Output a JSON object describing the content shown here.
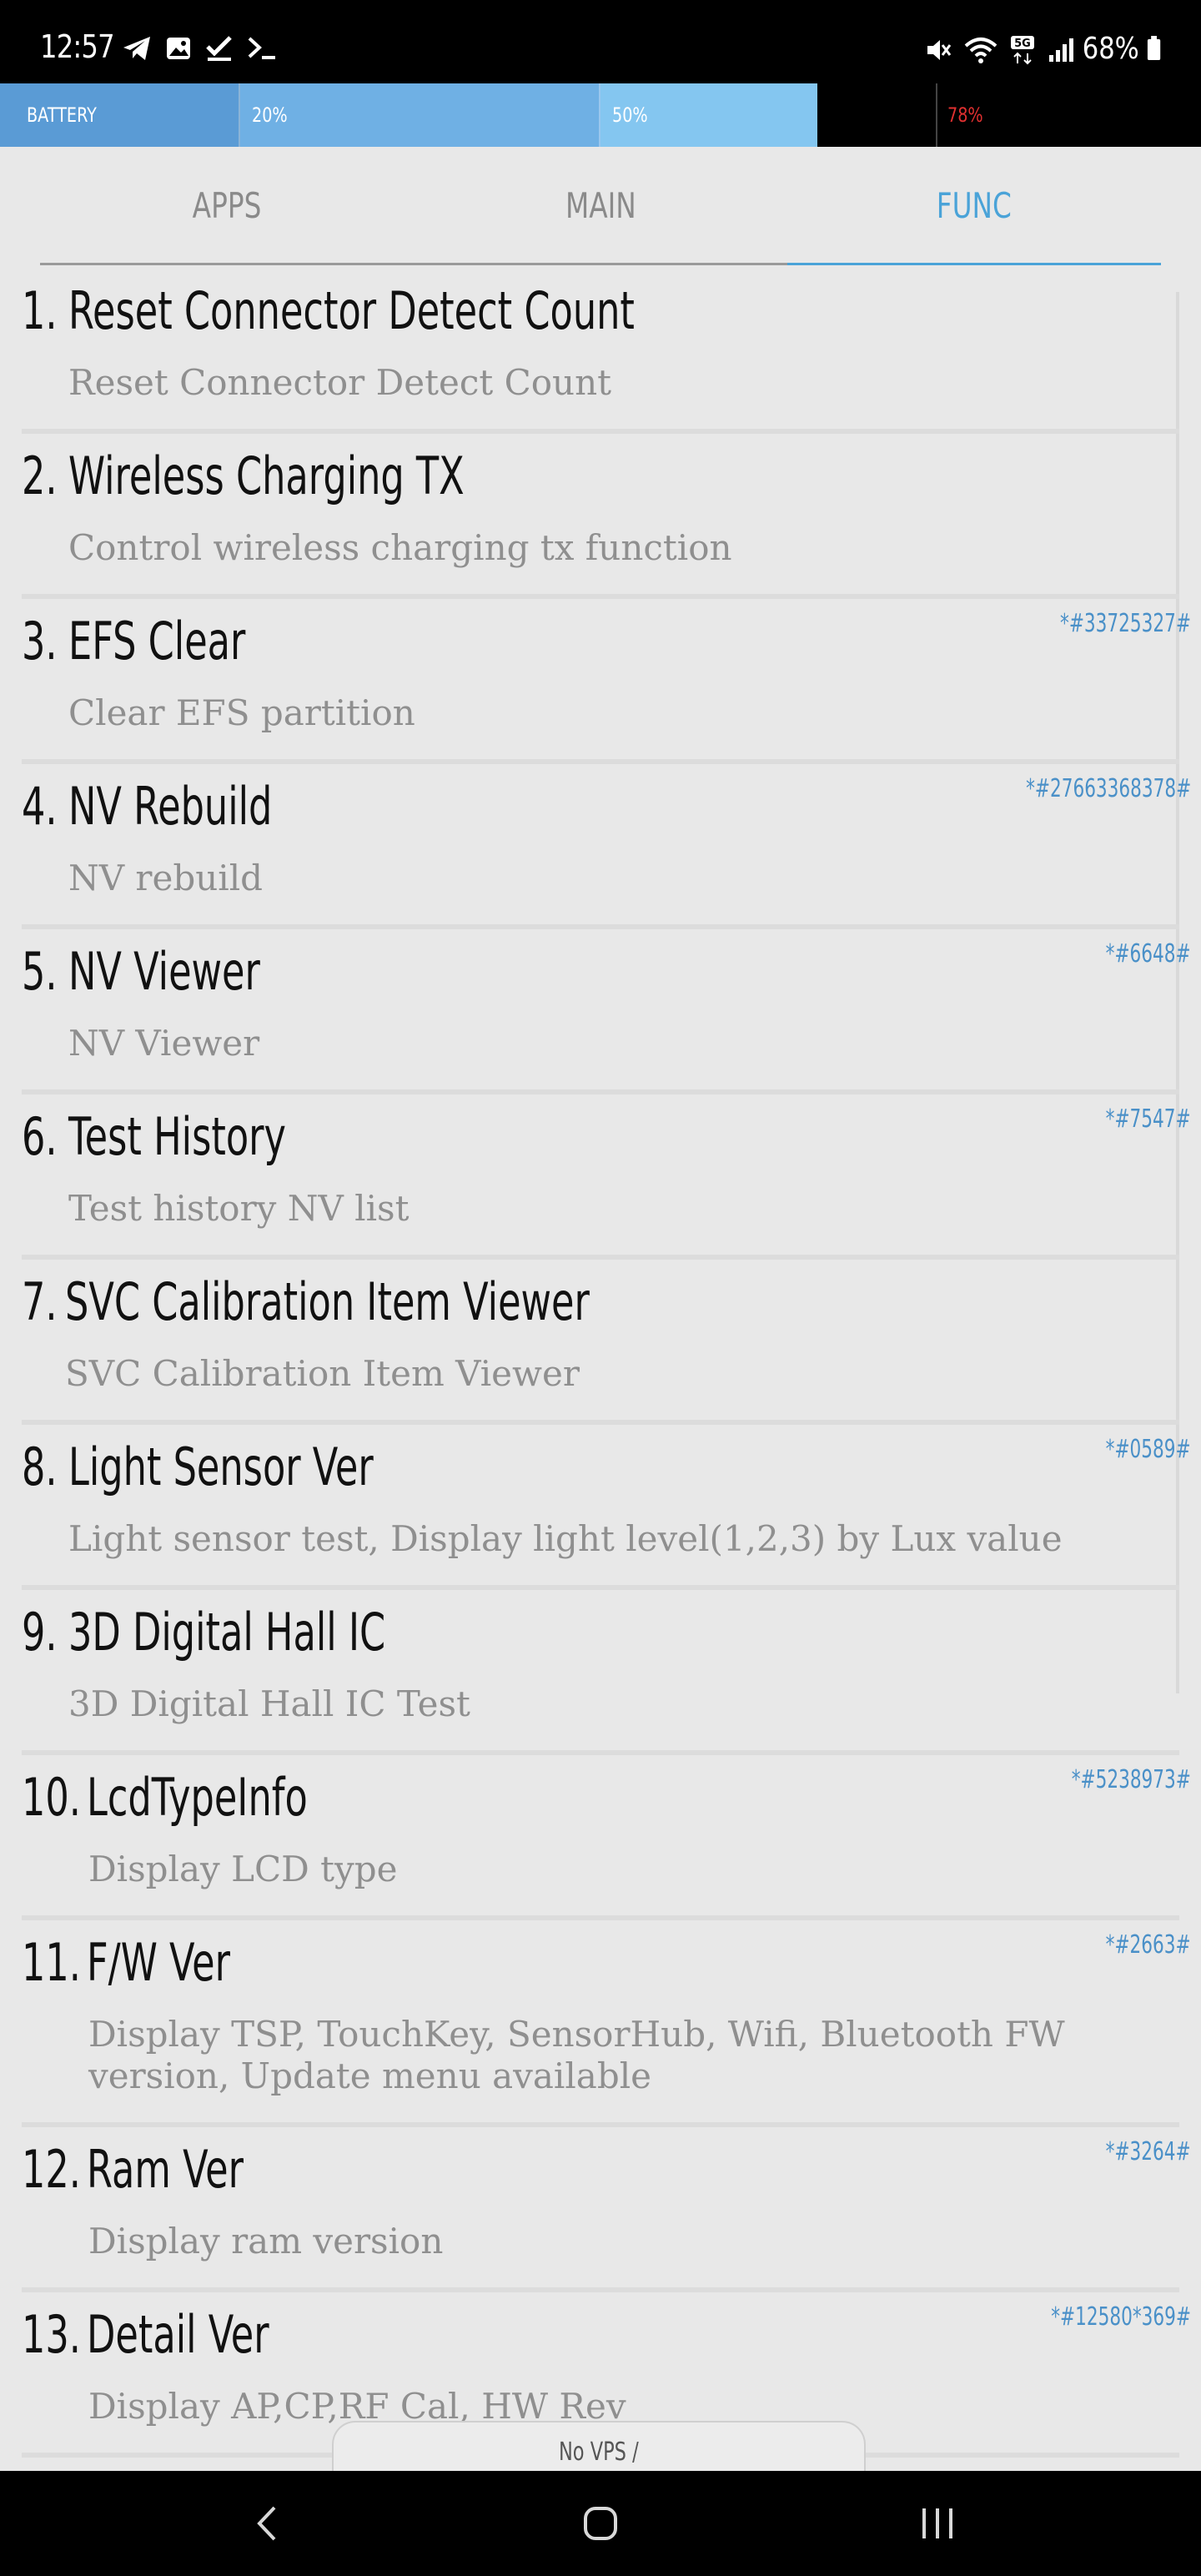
{
  "status_bar": {
    "time": "12:57",
    "battery_percent": "68%",
    "left_icons": [
      "telegram-icon",
      "gallery-icon",
      "checkmark-icon",
      "terminal-icon"
    ],
    "right_icons": [
      "mute-icon",
      "wifi-icon",
      "5g-icon",
      "signal-icon",
      "battery-icon"
    ]
  },
  "battery_bar": {
    "label": "BATTERY",
    "marker_20": "20%",
    "marker_50": "50%",
    "level": "78%",
    "level_color": "#e03030"
  },
  "tabs": [
    {
      "label": "APPS",
      "active": false
    },
    {
      "label": "MAIN",
      "active": false
    },
    {
      "label": "FUNC",
      "active": true
    }
  ],
  "accent_color": "#4aa3d8",
  "items": [
    {
      "num": "1.",
      "title": "Reset Connector Detect Count",
      "desc": "Reset Connector Detect Count",
      "code": ""
    },
    {
      "num": "2.",
      "title": "Wireless Charging TX",
      "desc": "Control wireless charging tx function",
      "code": ""
    },
    {
      "num": "3.",
      "title": "EFS Clear",
      "desc": "Clear EFS partition",
      "code": "*#33725327#"
    },
    {
      "num": "4.",
      "title": "NV Rebuild",
      "desc": "NV rebuild",
      "code": "*#27663368378#"
    },
    {
      "num": "5.",
      "title": "NV Viewer",
      "desc": "NV Viewer",
      "code": "*#6648#"
    },
    {
      "num": "6.",
      "title": "Test History",
      "desc": "Test history NV list",
      "code": "*#7547#"
    },
    {
      "num": "7.",
      "title": "SVC Calibration Item Viewer",
      "desc": "SVC Calibration Item Viewer",
      "code": ""
    },
    {
      "num": "8.",
      "title": "Light Sensor Ver",
      "desc": "Light sensor test, Display light level(1,2,3) by Lux value",
      "code": "*#0589#"
    },
    {
      "num": "9.",
      "title": "3D Digital Hall IC",
      "desc": "3D Digital Hall IC Test",
      "code": ""
    },
    {
      "num": "10.",
      "title": "LcdTypeInfo",
      "desc": "Display LCD type",
      "code": "*#5238973#"
    },
    {
      "num": "11.",
      "title": "F/W Ver",
      "desc": "Display TSP, TouchKey, SensorHub, Wifi, Bluetooth FW version, Update menu available",
      "code": "*#2663#"
    },
    {
      "num": "12.",
      "title": "Ram Ver",
      "desc": "Display ram version",
      "code": "*#3264#"
    },
    {
      "num": "13.",
      "title": "Detail Ver",
      "desc": "Display AP,CP,RF Cal, HW Rev",
      "code": "*#12580*369#"
    }
  ],
  "bottom_pill": "No VPS /",
  "nav": [
    "back-icon",
    "home-icon",
    "recents-icon"
  ]
}
